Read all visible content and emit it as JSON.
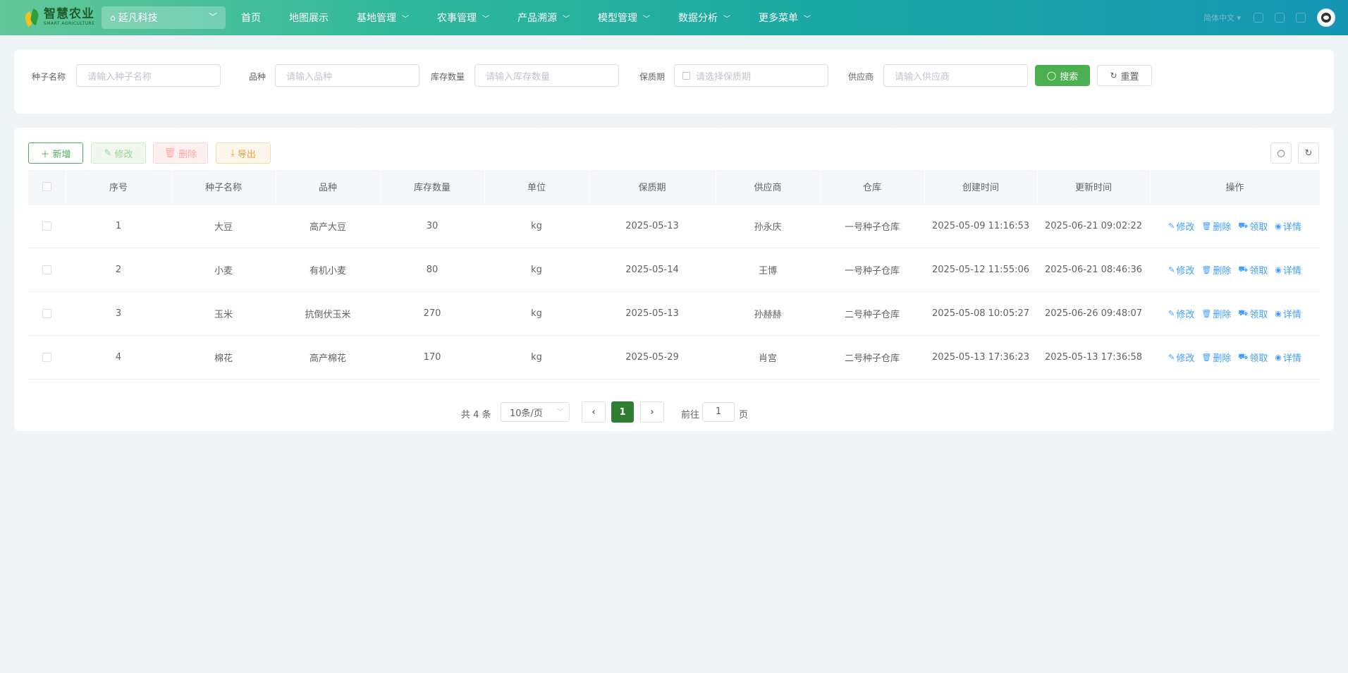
{
  "header": {
    "logo_title": "智慧农业",
    "logo_subtitle": "SMART AGRICULTURE",
    "company": "延凡科技",
    "nav": [
      {
        "label": "首页",
        "has_menu": false
      },
      {
        "label": "地图展示",
        "has_menu": false
      },
      {
        "label": "基地管理",
        "has_menu": true
      },
      {
        "label": "农事管理",
        "has_menu": true
      },
      {
        "label": "产品溯源",
        "has_menu": true
      },
      {
        "label": "模型管理",
        "has_menu": true
      },
      {
        "label": "数据分析",
        "has_menu": true
      },
      {
        "label": "更多菜单",
        "has_menu": true
      }
    ],
    "language": "简体中文"
  },
  "search": {
    "seed_name_label": "种子名称",
    "seed_name_placeholder": "请输入种子名称",
    "variety_label": "品种",
    "variety_placeholder": "请输入品种",
    "stock_label": "库存数量",
    "stock_placeholder": "请输入库存数量",
    "shelf_life_label": "保质期",
    "shelf_life_placeholder": "请选择保质期",
    "supplier_label": "供应商",
    "supplier_placeholder": "请输入供应商",
    "search_button": "搜索",
    "reset_button": "重置"
  },
  "toolbar": {
    "add": "新增",
    "edit": "修改",
    "delete": "删除",
    "export": "导出"
  },
  "table": {
    "columns": [
      "序号",
      "种子名称",
      "品种",
      "库存数量",
      "单位",
      "保质期",
      "供应商",
      "仓库",
      "创建时间",
      "更新时间",
      "操作"
    ],
    "rows": [
      {
        "index": "1",
        "name": "大豆",
        "variety": "高产大豆",
        "stock": "30",
        "unit": "kg",
        "shelf_life": "2025-05-13",
        "supplier": "孙永庆",
        "warehouse": "一号种子仓库",
        "created": "2025-05-09 11:16:53",
        "updated": "2025-06-21 09:02:22"
      },
      {
        "index": "2",
        "name": "小麦",
        "variety": "有机小麦",
        "stock": "80",
        "unit": "kg",
        "shelf_life": "2025-05-14",
        "supplier": "王博",
        "warehouse": "一号种子仓库",
        "created": "2025-05-12 11:55:06",
        "updated": "2025-06-21 08:46:36"
      },
      {
        "index": "3",
        "name": "玉米",
        "variety": "抗倒伏玉米",
        "stock": "270",
        "unit": "kg",
        "shelf_life": "2025-05-13",
        "supplier": "孙赫赫",
        "warehouse": "二号种子仓库",
        "created": "2025-05-08 10:05:27",
        "updated": "2025-06-26 09:48:07"
      },
      {
        "index": "4",
        "name": "棉花",
        "variety": "高产棉花",
        "stock": "170",
        "unit": "kg",
        "shelf_life": "2025-05-29",
        "supplier": "肖宫",
        "warehouse": "二号种子仓库",
        "created": "2025-05-13 17:36:23",
        "updated": "2025-05-13 17:36:58"
      }
    ],
    "actions": {
      "edit": "修改",
      "delete": "删除",
      "claim": "领取",
      "detail": "详情"
    }
  },
  "pagination": {
    "total": "共 4 条",
    "page_size": "10条/页",
    "current_page": "1",
    "goto_label": "前往",
    "goto_value": "1",
    "page_suffix": "页"
  },
  "colors": {
    "primary_green": "#4caf50",
    "active_page": "#2e7d32",
    "link_blue": "#409eff"
  }
}
